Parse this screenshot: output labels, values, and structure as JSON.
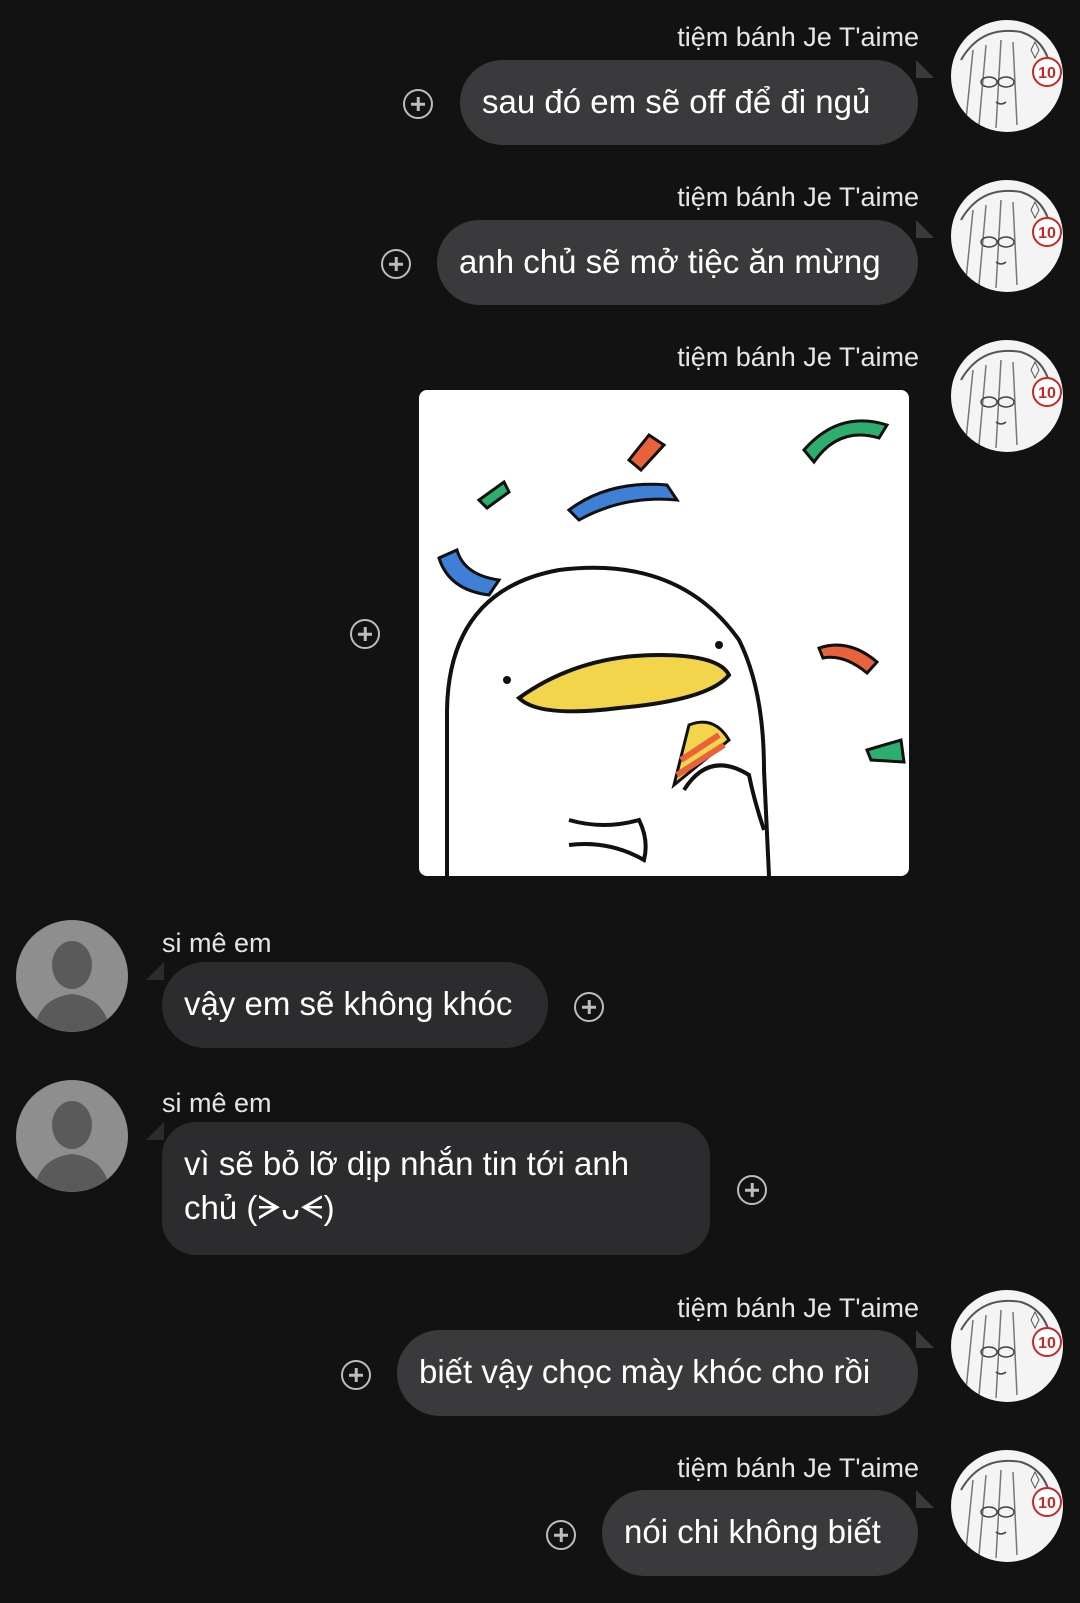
{
  "messages": [
    {
      "sender": "tiệm bánh Je T'aime",
      "text": "sau đó em sẽ off để đi ngủ"
    },
    {
      "sender": "tiệm bánh Je T'aime",
      "text": "anh chủ sẽ mở tiệc ăn mừng"
    },
    {
      "sender": "tiệm bánh Je T'aime",
      "sticker": "celebrating-duck-sticker"
    },
    {
      "sender": "si mê em",
      "text": "vậy em sẽ không khóc"
    },
    {
      "sender": "si mê em",
      "text": "vì sẽ bỏ lỡ dịp nhắn tin tới anh chủ (ᗒᴗᗕ)"
    },
    {
      "sender": "tiệm bánh Je T'aime",
      "text": "biết vậy chọc mày khóc cho rồi"
    },
    {
      "sender": "tiệm bánh Je T'aime",
      "text": "nói chi không biết"
    }
  ],
  "avatar_badge": "10",
  "icons": {
    "react": "plus-circle-icon",
    "avatar_shop": "anime-avatar-icon",
    "avatar_user": "default-person-icon"
  },
  "colors": {
    "background": "#121212",
    "bubble_outgoing": "#3a3a3c",
    "bubble_incoming": "#2c2c2e",
    "text": "#ffffff",
    "sticker_green": "#2eae6c",
    "sticker_blue": "#3f7fd6",
    "sticker_orange": "#e8623c",
    "sticker_yellow": "#f2d54a"
  }
}
